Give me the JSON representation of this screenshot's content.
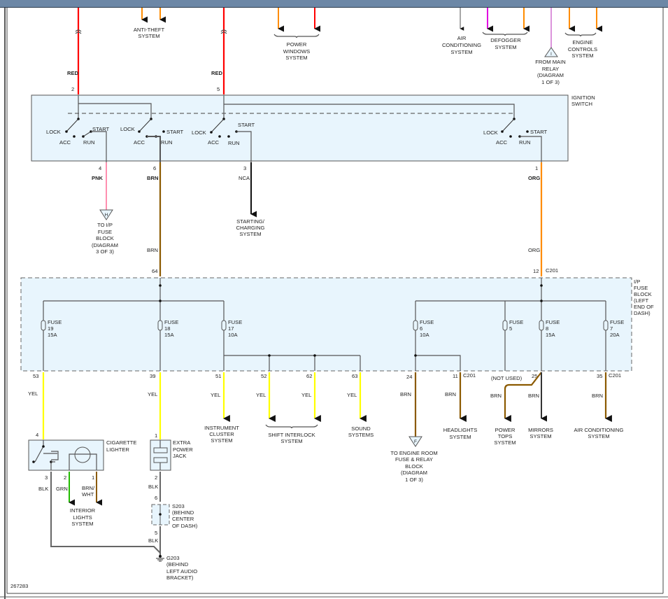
{
  "diagram_id": "267283",
  "colors": {
    "red": "#ff0000",
    "orange": "#ff8c00",
    "yellow": "#ffff00",
    "brown": "#8b5a00",
    "pink": "#ff8fb0",
    "magenta": "#e000e0",
    "black": "#111111",
    "gray": "#666666",
    "green": "#22bb00",
    "component_fill": "#e8f5fd",
    "header_bar": "#6c87a6"
  },
  "top": {
    "wire_left": {
      "color": "RED",
      "pin": "2"
    },
    "wire_right": {
      "color": "RED",
      "pin": "5"
    },
    "anti_theft": [
      "ANTI-THEFT",
      "SYSTEM"
    ],
    "power_windows": [
      "POWER",
      "WINDOWS",
      "SYSTEM"
    ],
    "air_conditioning": [
      "AIR",
      "CONDITIONING",
      "SYSTEM"
    ],
    "defogger": [
      "DEFOGGER",
      "SYSTEM"
    ],
    "main_relay": {
      "ref": "I",
      "lines": [
        "FROM MAIN",
        "RELAY",
        "(DIAGRAM",
        "1 OF 3)"
      ]
    },
    "engine_controls": [
      "ENGINE",
      "CONTROLS",
      "SYSTEM"
    ]
  },
  "ignition_switch": {
    "label": [
      "IGNITION",
      "SWITCH"
    ],
    "positions": {
      "lock": "LOCK",
      "acc": "ACC",
      "run": "RUN",
      "start": "START"
    },
    "outputs": [
      {
        "pin": "4",
        "color": "PNK"
      },
      {
        "pin": "6",
        "color": "BRN"
      },
      {
        "pin": "3",
        "color": "NCA"
      },
      {
        "pin": "1",
        "color": "ORG"
      }
    ]
  },
  "middle": {
    "ip_fuse_ref": {
      "ref": "H",
      "lines": [
        "TO I/P",
        "FUSE",
        "BLOCK",
        "(DIAGRAM",
        "3 OF 3)"
      ]
    },
    "starting": [
      "STARTING/",
      "CHARGING",
      "SYSTEM"
    ],
    "brn_label": "BRN",
    "org_label": "ORG",
    "pin_64": "64",
    "pin_12": "12",
    "c201": "C201"
  },
  "fuse_block": {
    "label": [
      "I/P",
      "FUSE",
      "BLOCK",
      "(LEFT",
      "END OF",
      "DASH)"
    ],
    "fuses": [
      {
        "word": "FUSE",
        "num": "19",
        "amps": "15A"
      },
      {
        "word": "FUSE",
        "num": "18",
        "amps": "15A"
      },
      {
        "word": "FUSE",
        "num": "17",
        "amps": "10A"
      },
      {
        "word": "FUSE",
        "num": "6",
        "amps": "10A"
      },
      {
        "word": "FUSE",
        "num": "5",
        "amps": ""
      },
      {
        "word": "FUSE",
        "num": "8",
        "amps": "15A"
      },
      {
        "word": "FUSE",
        "num": "7",
        "amps": "20A"
      }
    ],
    "outputs": [
      {
        "pin": "53",
        "color": "YEL"
      },
      {
        "pin": "39",
        "color": "YEL"
      },
      {
        "pin": "51",
        "color": "YEL"
      },
      {
        "pin": "52",
        "color": "YEL"
      },
      {
        "pin": "62",
        "color": "YEL"
      },
      {
        "pin": "63",
        "color": "YEL"
      },
      {
        "pin": "24",
        "color": "BRN"
      },
      {
        "pin": "11",
        "color": "BRN",
        "connector": "C201"
      },
      {
        "pin": "(NOT USED)",
        "color": "BRN"
      },
      {
        "pin": "25",
        "color": "BRN"
      },
      {
        "pin": "35",
        "color": "BRN",
        "connector": "C201"
      }
    ]
  },
  "destinations": {
    "instrument_cluster": [
      "INSTRUMENT",
      "CLUSTER",
      "SYSTEM"
    ],
    "shift_interlock": [
      "SHIFT INTERLOCK",
      "SYSTEM"
    ],
    "sound": [
      "SOUND",
      "SYSTEMS"
    ],
    "engine_room": {
      "ref": "F",
      "lines": [
        "TO ENGINE ROOM",
        "FUSE & RELAY",
        "BLOCK",
        "(DIAGRAM",
        "1 OF 3)"
      ]
    },
    "headlights": [
      "HEADLIGHTS",
      "SYSTEM"
    ],
    "power_tops": [
      "POWER",
      "TOPS",
      "SYSTEM"
    ],
    "mirrors": [
      "MIRRORS",
      "SYSTEM"
    ],
    "air_conditioning": [
      "AIR CONDITIONING",
      "SYSTEM"
    ]
  },
  "cigarette_lighter": {
    "label": [
      "CIGARETTE",
      "LIGHTER"
    ],
    "pin_in": "4",
    "pins": [
      {
        "pin": "3",
        "color": "BLK"
      },
      {
        "pin": "2",
        "color": "GRN"
      },
      {
        "pin": "1",
        "color": [
          "BRN/",
          "WHT"
        ]
      }
    ],
    "interior_lights": [
      "INTERIOR",
      "LIGHTS",
      "SYSTEM"
    ]
  },
  "power_jack": {
    "label": [
      "EXTRA",
      "POWER",
      "JACK"
    ],
    "pin_in": "1",
    "pin_out": "2",
    "color_out": "BLK"
  },
  "splice": {
    "pin_in": "6",
    "pin_out": "5",
    "color": "BLK",
    "lines": [
      "S203",
      "(BEHIND",
      "CENTER",
      "OF DASH)"
    ]
  },
  "ground": {
    "lines": [
      "G203",
      "(BEHIND",
      "LEFT AUDIO",
      "BRACKET)"
    ]
  }
}
